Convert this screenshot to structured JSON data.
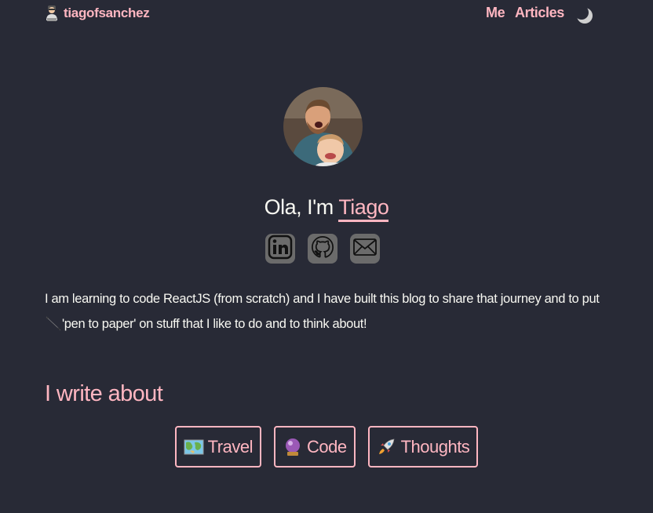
{
  "header": {
    "brand": "tiagofsanchez",
    "brand_icon": "developer-avatar-icon",
    "nav": [
      {
        "label": "Me"
      },
      {
        "label": "Articles"
      }
    ],
    "theme_toggle_icon": "moon-icon"
  },
  "hero": {
    "greeting_prefix": "Ola, I'm ",
    "name": "Tiago",
    "socials": [
      {
        "icon": "linkedin-icon"
      },
      {
        "icon": "github-icon"
      },
      {
        "icon": "email-icon"
      }
    ]
  },
  "intro": {
    "text_line1": "I am learning to code ReactJS (from scratch) and I have built this blog to share that journey and to put",
    "text_line2": "'pen to paper' on stuff that I like to do and to think about!",
    "pen_icon": "pen-icon"
  },
  "topics": {
    "title": "I write about",
    "items": [
      {
        "label": "Travel",
        "icon": "map-icon"
      },
      {
        "label": "Code",
        "icon": "crystal-ball-icon"
      },
      {
        "label": "Thoughts",
        "icon": "rocket-icon"
      }
    ]
  },
  "colors": {
    "background": "#282a36",
    "accent": "#ffb6c1",
    "text": "#f8f8f2"
  }
}
